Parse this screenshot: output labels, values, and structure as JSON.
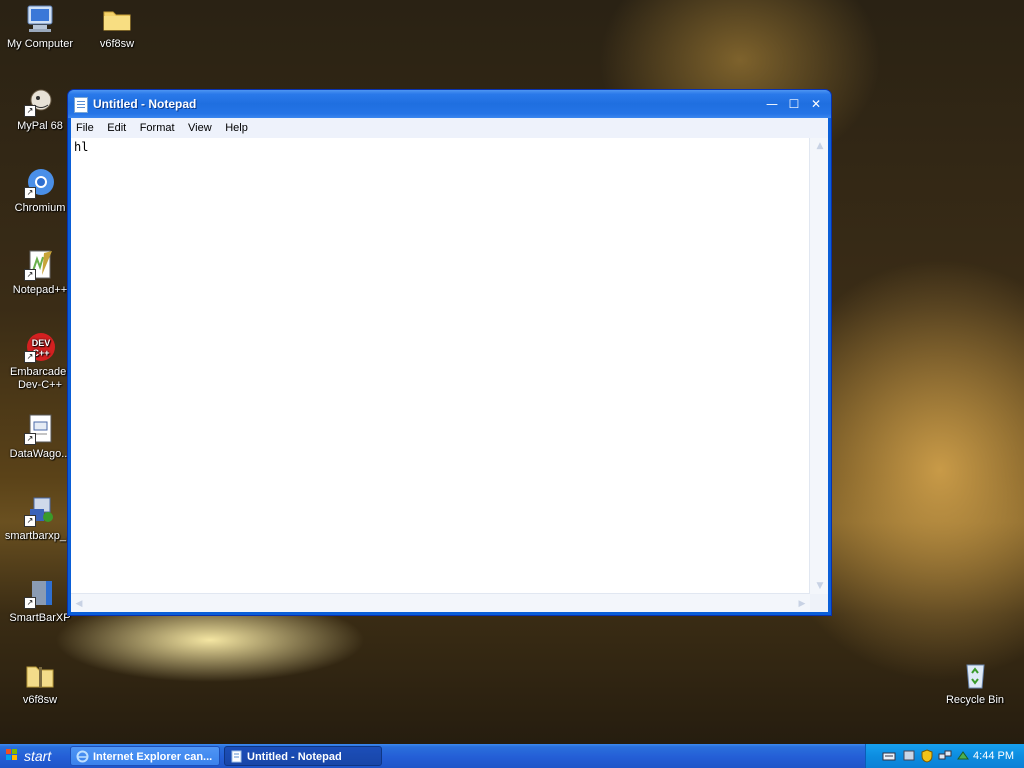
{
  "desktop": {
    "icons": [
      {
        "label": "My Computer"
      },
      {
        "label": "v6f8sw"
      },
      {
        "label": "MyPal 68"
      },
      {
        "label": "Chromium"
      },
      {
        "label": "Notepad++"
      },
      {
        "label": "Embarcader\nDev-C++"
      },
      {
        "label": "DataWago..."
      },
      {
        "label": "smartbarxp_..."
      },
      {
        "label": "SmartBarXP"
      },
      {
        "label": "v6f8sw"
      },
      {
        "label": "Recycle Bin"
      }
    ]
  },
  "window": {
    "title": "Untitled - Notepad",
    "menu": [
      "File",
      "Edit",
      "Format",
      "View",
      "Help"
    ],
    "content": "hl",
    "buttons": {
      "minimize": "—",
      "maximize": "☐",
      "close": "✕"
    }
  },
  "taskbar": {
    "start_label": "start",
    "tasks": [
      {
        "label": "Internet Explorer can..."
      },
      {
        "label": "Untitled - Notepad"
      }
    ],
    "clock": "4:44 PM"
  },
  "colors": {
    "titlebar": "#1f6fe0",
    "taskbar": "#245ed6",
    "tray": "#0d8de0",
    "start_green": "#3a9a2a"
  }
}
